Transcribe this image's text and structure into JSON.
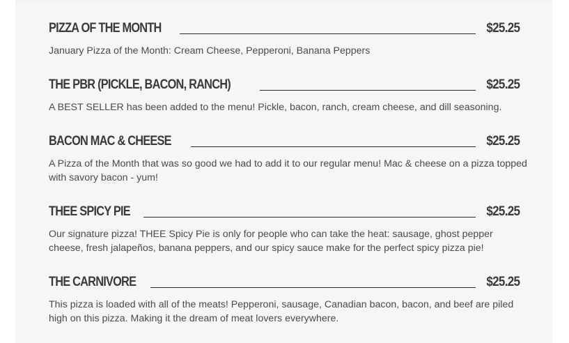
{
  "menu_items": [
    {
      "title": "Pizza of the Month",
      "price": "$25.25",
      "description": "January Pizza of the Month: Cream Cheese, Pepperoni, Banana Peppers"
    },
    {
      "title": "The PBR (Pickle, Bacon, Ranch)",
      "price": "$25.25",
      "description": "A BEST SELLER has been added to the menu! Pickle, bacon, ranch, cream cheese, and dill seasoning."
    },
    {
      "title": "Bacon Mac & Cheese",
      "price": "$25.25",
      "description": "A Pizza of the Month that was so good we had to add it to our regular menu! Mac & cheese on a pizza topped with savory bacon - yum!"
    },
    {
      "title": "Thee Spicy Pie",
      "price": "$25.25",
      "description": "Our signature pizza! THEE Spicy Pie is only for people who can take the heat: sausage, ghost pepper cheese, fresh jalapeños, banana peppers, and our spicy sauce make for the perfect spicy pizza pie!"
    },
    {
      "title": "The Carnivore",
      "price": "$25.25",
      "description": "This pizza is loaded with all of the meats! Pepperoni, sausage, Canadian bacon, bacon, and beef are piled high on this pizza. Making it the dream of meat lovers everywhere."
    }
  ]
}
